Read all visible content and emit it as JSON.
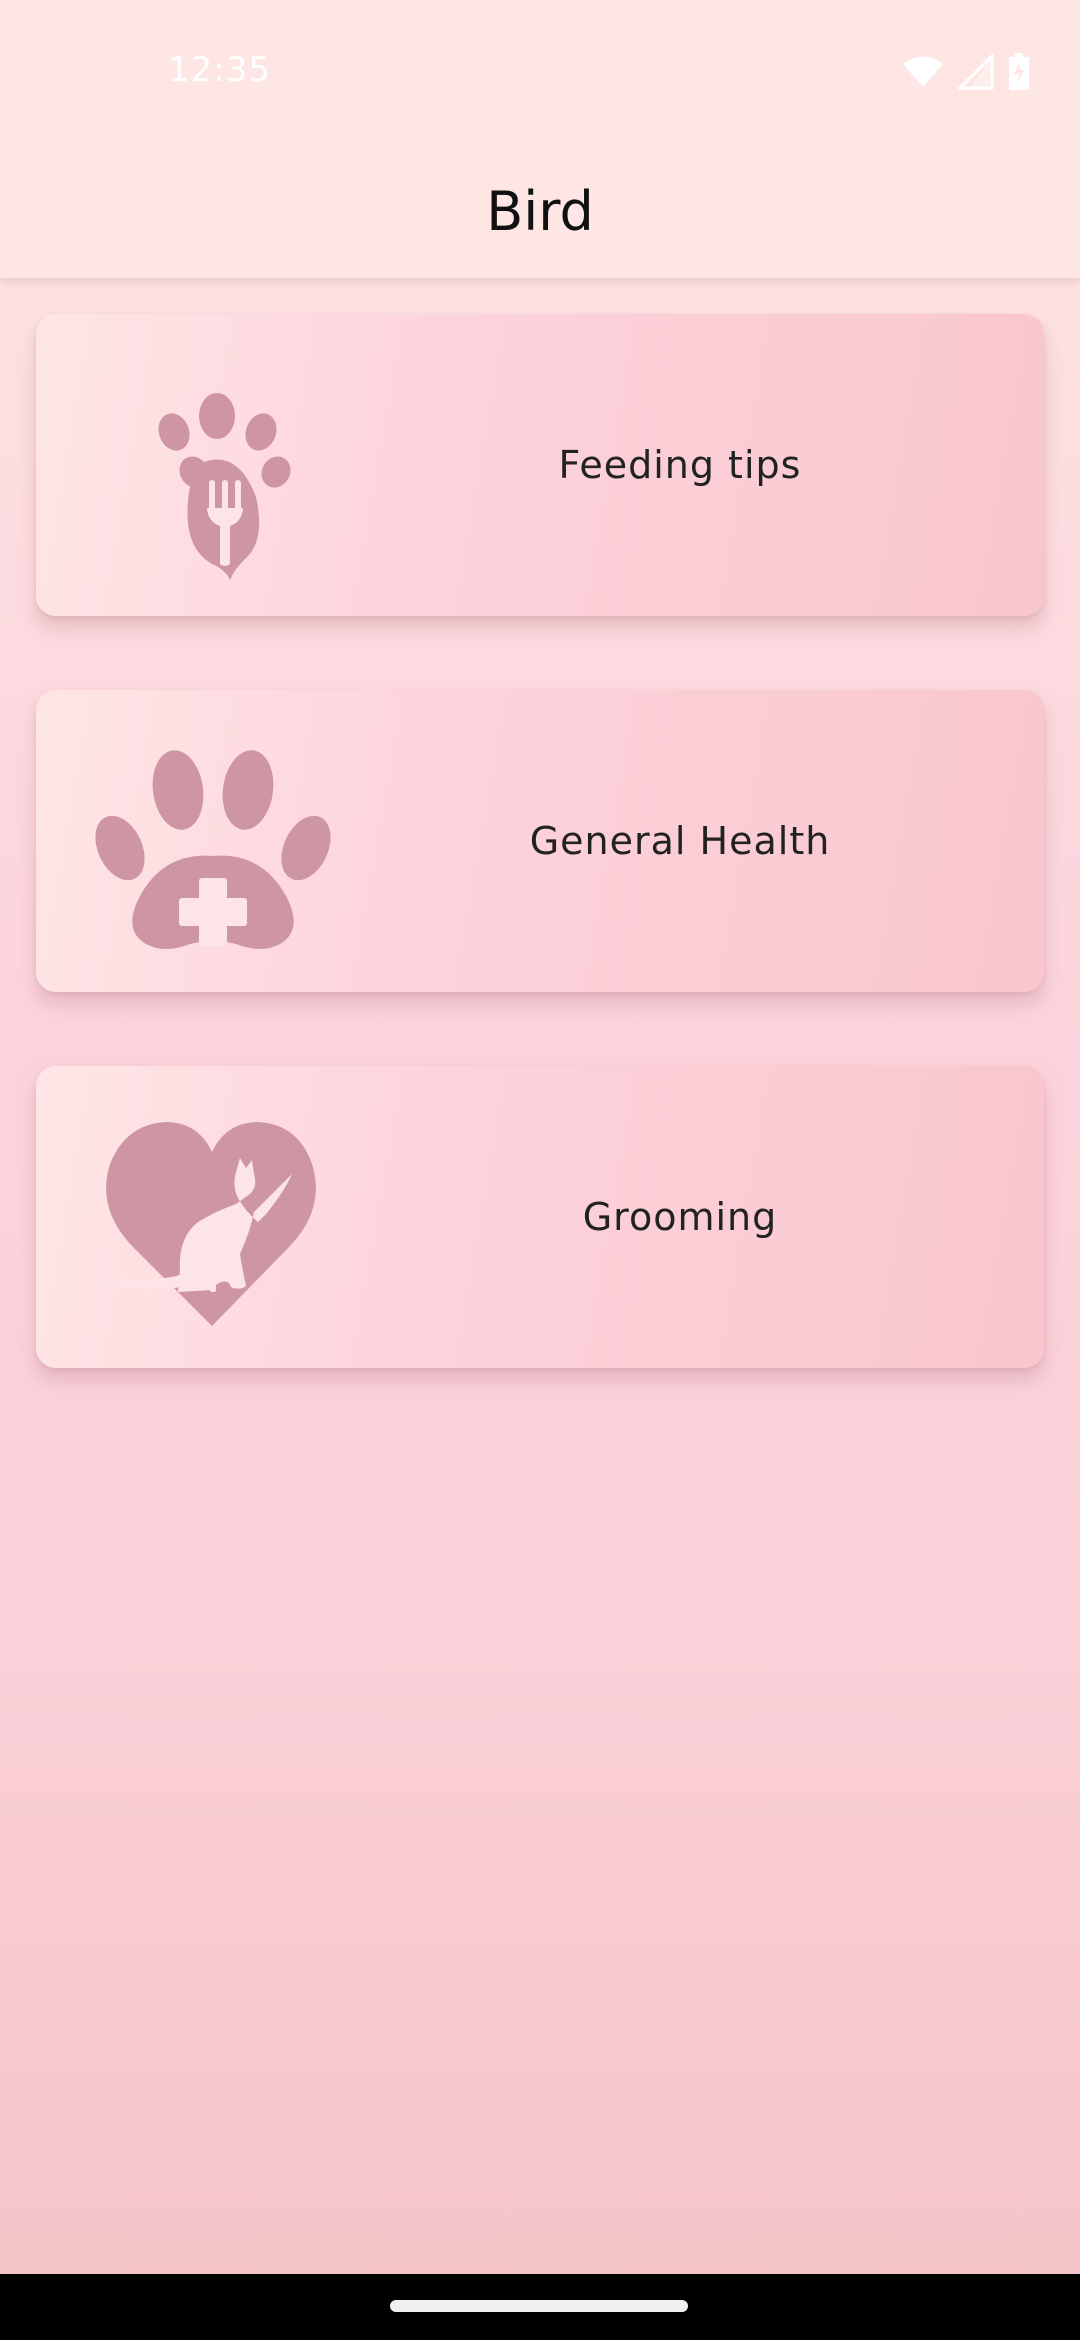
{
  "status_bar": {
    "time": "12:35",
    "icons": [
      "wifi-icon",
      "cell-signal-icon",
      "battery-icon"
    ]
  },
  "app_bar": {
    "title": "Bird"
  },
  "cards": [
    {
      "label": "Feeding tips",
      "icon": "paw-fork-icon"
    },
    {
      "label": "General Health",
      "icon": "paw-medical-cross-icon"
    },
    {
      "label": "Grooming",
      "icon": "heart-cat-icon"
    }
  ],
  "colors": {
    "icon": "#cd96a2",
    "card_start": "#fee6e6",
    "card_end": "#f8c6cc",
    "app_bar": "#fee6e4"
  }
}
